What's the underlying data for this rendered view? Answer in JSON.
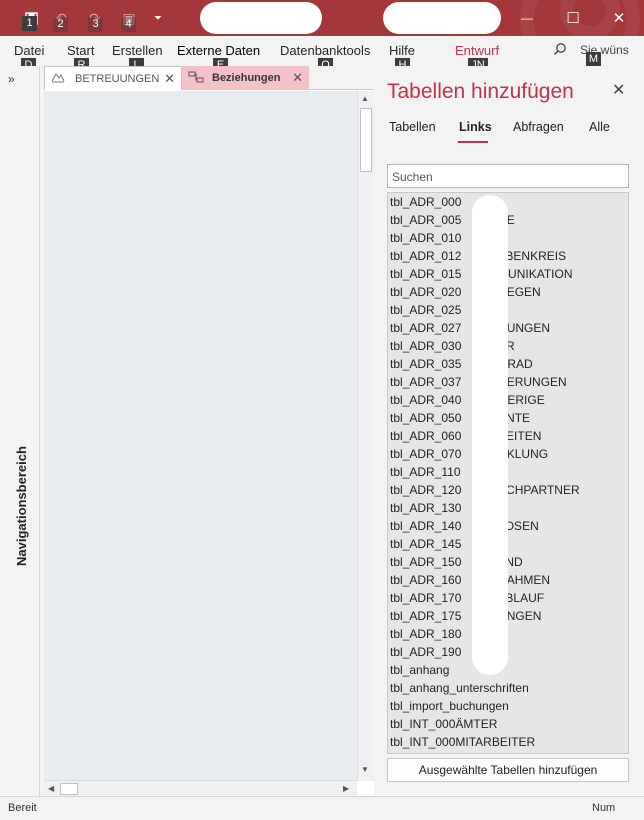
{
  "colors": {
    "title_bar": "#a4373a",
    "accent": "#c4314b",
    "active_doc_tab": "#f5c1c9"
  },
  "quick_access": {
    "keytips": [
      "1",
      "2",
      "3",
      "4"
    ],
    "icons": [
      "save-icon",
      "undo-icon",
      "redo-icon",
      "clipboard-icon",
      "customize-dropdown-icon"
    ]
  },
  "window_controls": {
    "minimize": "—",
    "maximize": "☐",
    "close": "✕"
  },
  "ribbon": {
    "tabs": [
      {
        "label": "Datei",
        "keytip": "D"
      },
      {
        "label": "Start",
        "keytip": "R"
      },
      {
        "label": "Erstellen",
        "keytip": "L"
      },
      {
        "label": "Externe Daten",
        "keytip": "E"
      },
      {
        "label": "Datenbanktools",
        "keytip": "O"
      },
      {
        "label": "Hilfe",
        "keytip": "H"
      },
      {
        "label": "Entwurf",
        "keytip": "JN"
      }
    ],
    "tell_me": "Sie wüns",
    "tell_me_keytip": "M"
  },
  "navigation": {
    "toggle": "»",
    "label": "Navigationsbereich"
  },
  "doc_tabs": [
    {
      "label": "BETREUUNGEN",
      "close": "✕"
    },
    {
      "label": "Beziehungen",
      "close": "✕"
    }
  ],
  "pane": {
    "title": "Tabellen hinzufügen",
    "close": "✕",
    "tabs": [
      "Tabellen",
      "Links",
      "Abfragen",
      "Alle"
    ],
    "active_tab": "Links",
    "search_placeholder": "Suchen",
    "items": [
      "tbl_ADR_000",
      "tbl_ADR_005           NE",
      "tbl_ADR_010",
      "tbl_ADR_012           ABENKREIS",
      "tbl_ADR_015           MUNIKATION",
      "tbl_ADR_020           DEGEN",
      "tbl_ADR_025           T",
      "tbl_ADR_027           UUNGEN",
      "tbl_ADR_030           ER",
      "tbl_ADR_035           GRAD",
      "tbl_ADR_037           HERUNGEN",
      "tbl_ADR_040           OERIGE",
      "tbl_ADR_050           ENTE",
      "tbl_ADR_060           KEITEN",
      "tbl_ADR_070           CKLUNG",
      "tbl_ADR_110           N",
      "tbl_ADR_120           ECHPARTNER",
      "tbl_ADR_130           E",
      "tbl_ADR_140           LOSEN",
      "tbl_ADR_145",
      "tbl_ADR_150           AND",
      "tbl_ADR_160           NAHMEN",
      "tbl_ADR_170           ABLAUF",
      "tbl_ADR_175           UNGEN",
      "tbl_ADR_180",
      "tbl_ADR_190",
      "tbl_anhang",
      "tbl_anhang_unterschriften",
      "tbl_import_buchungen",
      "tbl_INT_000ÄMTER",
      "tbl_INT_000MITARBEITER"
    ],
    "add_button": "Ausgewählte Tabellen hinzufügen"
  },
  "status_bar": {
    "left": "Bereit",
    "right": "Num"
  }
}
